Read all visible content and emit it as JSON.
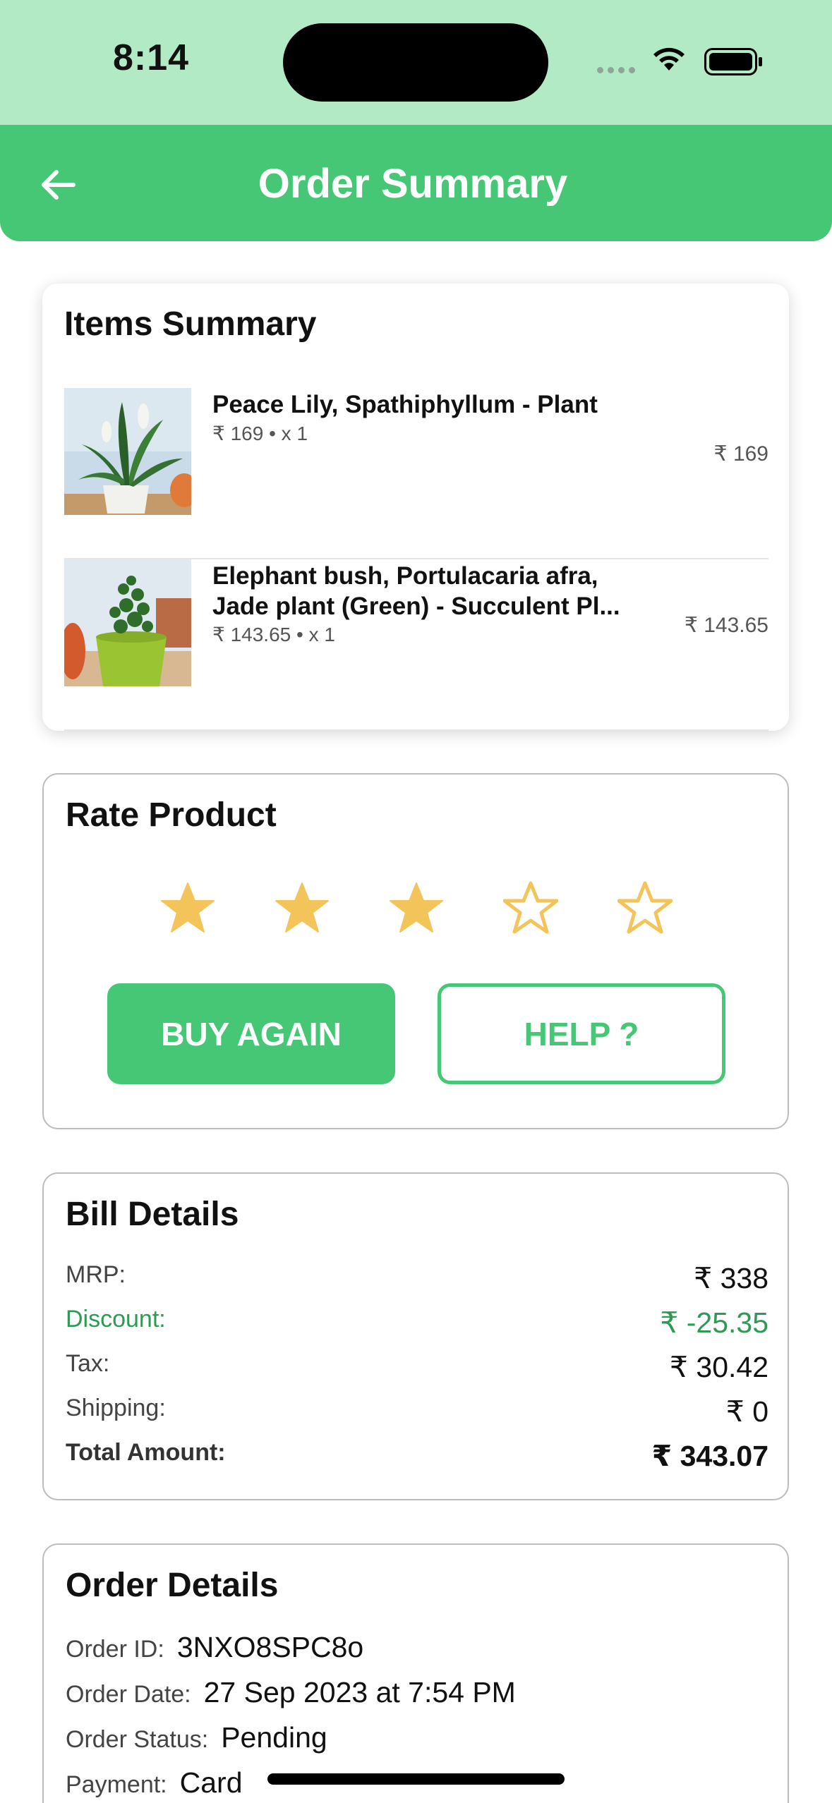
{
  "status_bar": {
    "time": "8:14"
  },
  "header": {
    "title": "Order Summary"
  },
  "items_summary": {
    "title": "Items Summary",
    "items": [
      {
        "name": "Peace Lily, Spathiphyllum - Plant",
        "meta": "₹ 169 • x 1",
        "price": "₹ 169"
      },
      {
        "name": "Elephant bush, Portulacaria afra, Jade plant (Green) - Succulent Pl...",
        "meta": "₹ 143.65 • x 1",
        "price": "₹ 143.65"
      }
    ]
  },
  "rate_product": {
    "title": "Rate Product",
    "rating": 3,
    "max_rating": 5,
    "buy_again_label": "BUY AGAIN",
    "help_label": "HELP ?"
  },
  "bill_details": {
    "title": "Bill Details",
    "rows": [
      {
        "label": "MRP:",
        "value": "₹ 338"
      },
      {
        "label": "Discount:",
        "value": "₹ -25.35"
      },
      {
        "label": "Tax:",
        "value": "₹ 30.42"
      },
      {
        "label": "Shipping:",
        "value": "₹ 0"
      },
      {
        "label": "Total Amount:",
        "value": "₹ 343.07"
      }
    ]
  },
  "order_details": {
    "title": "Order Details",
    "rows": [
      {
        "label": "Order ID:",
        "value": "3NXO8SPC8o"
      },
      {
        "label": "Order Date:",
        "value": "27 Sep 2023 at 7:54 PM"
      },
      {
        "label": "Order Status:",
        "value": "Pending"
      },
      {
        "label": "Payment:",
        "value": "Card"
      }
    ]
  },
  "colors": {
    "primary_green": "#45c775",
    "status_bar_bg": "#b3eac6",
    "star_gold": "#f2c45a",
    "discount_green": "#2e9a55"
  },
  "icons": {
    "back": "arrow-left-icon",
    "star_filled": "star-filled-icon",
    "star_empty": "star-outline-icon",
    "wifi": "wifi-icon",
    "battery": "battery-icon"
  }
}
